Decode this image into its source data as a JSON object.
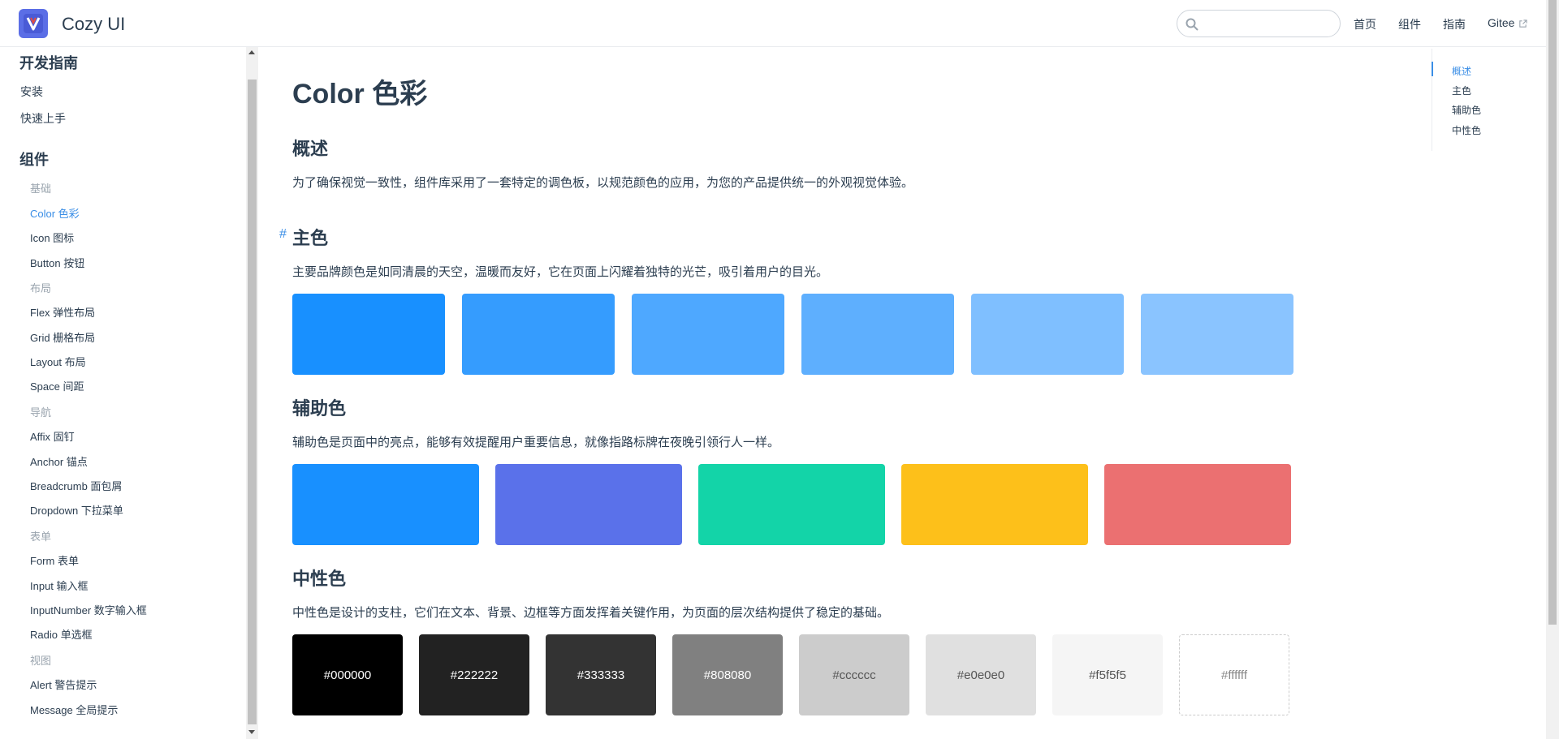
{
  "navbar": {
    "brand": "Cozy UI",
    "search_placeholder": "",
    "links": [
      "首页",
      "组件",
      "指南",
      "Gitee"
    ]
  },
  "sidebar": {
    "section1": "开发指南",
    "guide_items": [
      "安装",
      "快速上手"
    ],
    "section2": "组件",
    "groups": {
      "basic": "基础",
      "layout": "布局",
      "nav": "导航",
      "form": "表单",
      "view": "视图"
    },
    "basic_items": [
      "Color 色彩",
      "Icon 图标",
      "Button 按钮"
    ],
    "layout_items": [
      "Flex 弹性布局",
      "Grid 栅格布局",
      "Layout 布局",
      "Space 间距"
    ],
    "nav_items": [
      "Affix 固钉",
      "Anchor 锚点",
      "Breadcrumb 面包屑",
      "Dropdown 下拉菜单"
    ],
    "form_items": [
      "Form 表单",
      "Input 输入框",
      "InputNumber 数字输入框",
      "Radio 单选框"
    ],
    "view_items": [
      "Alert 警告提示",
      "Message 全局提示"
    ]
  },
  "content": {
    "title": "Color 色彩",
    "overview_title": "概述",
    "overview_text": "为了确保视觉一致性，组件库采用了一套特定的调色板，以规范颜色的应用，为您的产品提供统一的外观视觉体验。",
    "primary_title": "主色",
    "primary_text": "主要品牌颜色是如同清晨的天空，温暖而友好，它在页面上闪耀着独特的光芒，吸引着用户的目光。",
    "primary_colors": [
      "#1890ff",
      "#359cfe",
      "#4ea8ff",
      "#5eaffe",
      "#7fbfff",
      "#8ac4ff"
    ],
    "secondary_title": "辅助色",
    "secondary_text": "辅助色是页面中的亮点，能够有效提醒用户重要信息，就像指路标牌在夜晚引领行人一样。",
    "secondary_colors": [
      "#1890ff",
      "#5a71ea",
      "#13d4a8",
      "#fdc01a",
      "#eb7071"
    ],
    "neutral_title": "中性色",
    "neutral_text": "中性色是设计的支柱，它们在文本、背景、边框等方面发挥着关键作用，为页面的层次结构提供了稳定的基础。",
    "neutral_colors": [
      {
        "label": "#000000",
        "bg": "#000000",
        "fg": "#ffffff"
      },
      {
        "label": "#222222",
        "bg": "#222222",
        "fg": "#ffffff"
      },
      {
        "label": "#333333",
        "bg": "#333333",
        "fg": "#ffffff"
      },
      {
        "label": "#808080",
        "bg": "#808080",
        "fg": "#ffffff"
      },
      {
        "label": "#cccccc",
        "bg": "#cccccc",
        "fg": "#555555"
      },
      {
        "label": "#e0e0e0",
        "bg": "#e0e0e0",
        "fg": "#555555"
      },
      {
        "label": "#f5f5f5",
        "bg": "#f5f5f5",
        "fg": "#555555"
      },
      {
        "label": "#ffffff",
        "bg": "#ffffff",
        "fg": "#888888"
      }
    ]
  },
  "toc": [
    "概述",
    "主色",
    "辅助色",
    "中性色"
  ],
  "accent": "#3a8ee6"
}
